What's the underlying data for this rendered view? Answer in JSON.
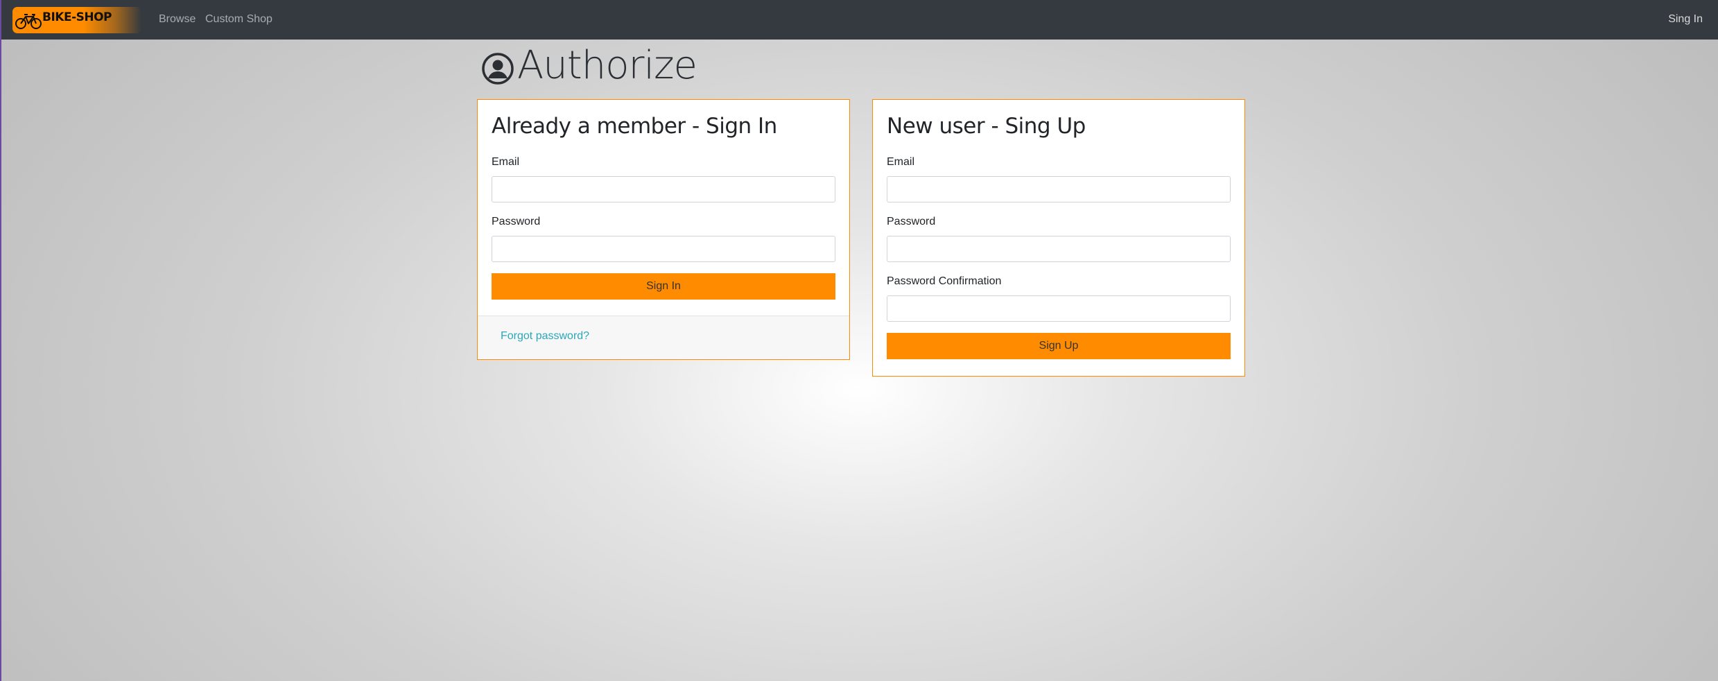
{
  "navbar": {
    "brand": "BIKE-SHOP",
    "links": [
      "Browse",
      "Custom Shop"
    ],
    "signin_label": "Sing In"
  },
  "page": {
    "title": "Authorize",
    "icon": "user-circle-icon"
  },
  "signin": {
    "title": "Already a member - Sign In",
    "email_label": "Email",
    "email_value": "",
    "password_label": "Password",
    "password_value": "",
    "button_label": "Sign In",
    "forgot_label": "Forgot password?"
  },
  "signup": {
    "title": "New user - Sing Up",
    "email_label": "Email",
    "email_value": "",
    "password_label": "Password",
    "password_value": "",
    "confirm_label": "Password Confirmation",
    "confirm_value": "",
    "button_label": "Sign Up"
  },
  "colors": {
    "accent": "#ff8c00",
    "navbar": "#343a40",
    "link": "#2aa8b8"
  }
}
